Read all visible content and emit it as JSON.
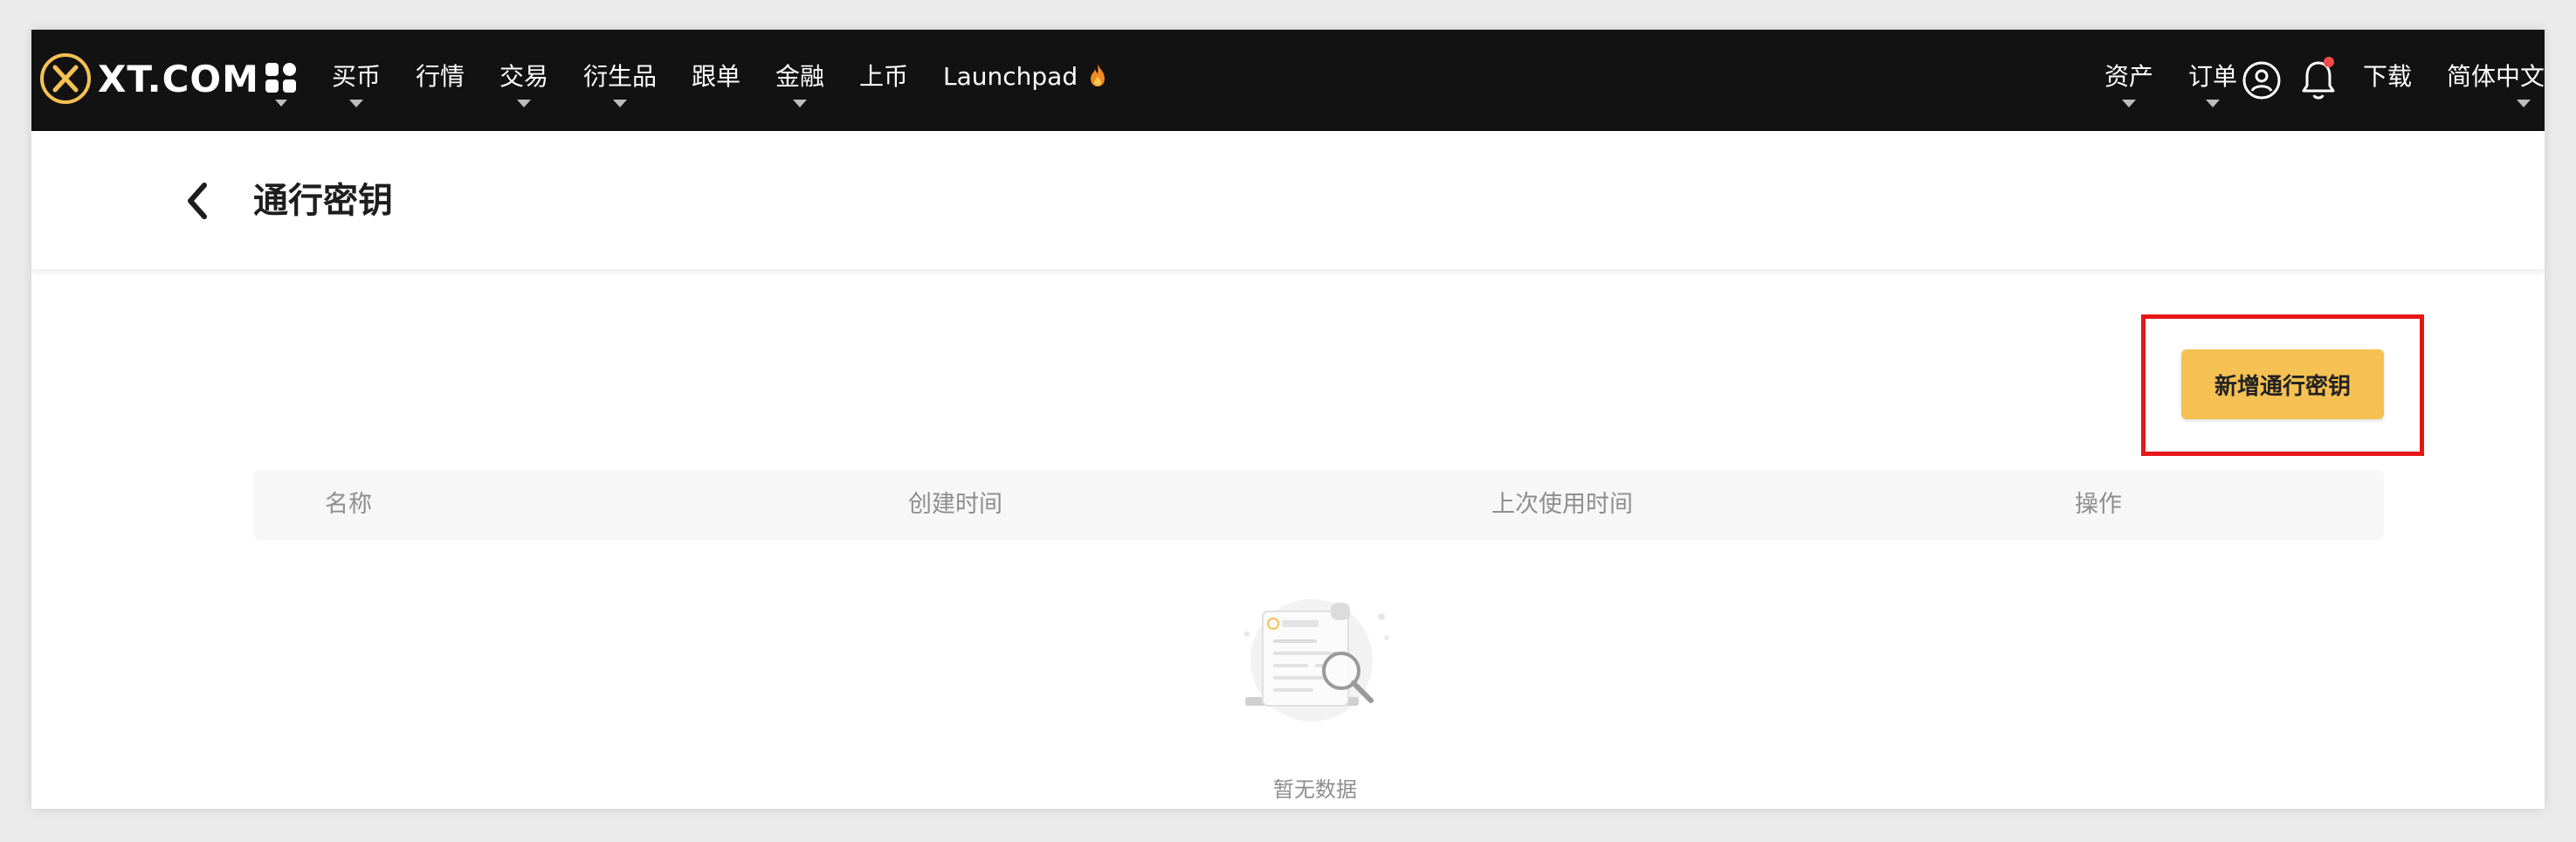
{
  "nav": {
    "logo_text": "XT.COM",
    "items": [
      {
        "label": "买币"
      },
      {
        "label": "行情"
      },
      {
        "label": "交易"
      },
      {
        "label": "衍生品"
      },
      {
        "label": "跟单"
      },
      {
        "label": "金融"
      },
      {
        "label": "上币"
      },
      {
        "label": "Launchpad"
      }
    ],
    "right_items": [
      {
        "label": "资产"
      },
      {
        "label": "订单"
      },
      {
        "label": "下载"
      },
      {
        "label": "简体中文"
      }
    ],
    "icons": {
      "apps": "apps-grid-icon",
      "user": "user-circle-icon",
      "bell": "bell-icon",
      "fire": "fire-icon",
      "back": "chevron-left-icon"
    },
    "notification_dot_color": "#f04b4b"
  },
  "page": {
    "title": "通行密钥",
    "add_button_label": "新增通行密钥",
    "accent_color": "#f5c153",
    "highlight_color": "#e61717"
  },
  "table": {
    "columns": [
      {
        "label": "名称"
      },
      {
        "label": "创建时间"
      },
      {
        "label": "上次使用时间"
      },
      {
        "label": "操作"
      }
    ],
    "rows": [],
    "empty_text": "暂无数据"
  }
}
